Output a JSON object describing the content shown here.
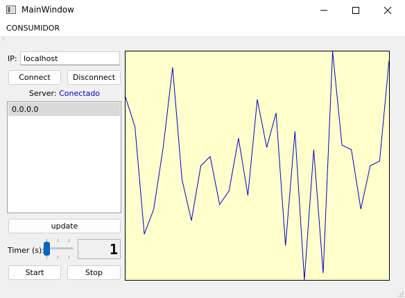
{
  "window": {
    "title": "MainWindow",
    "controls": [
      "minimize-icon",
      "maximize-icon",
      "close-icon"
    ]
  },
  "menu": {
    "items": [
      "CONSUMIDOR"
    ]
  },
  "connection": {
    "ip_label": "IP:",
    "ip_value": "localhost",
    "connect_label": "Connect",
    "disconnect_label": "Disconnect",
    "server_label": "Server:",
    "server_status": "Conectado",
    "status_color": "#0000cc"
  },
  "server_list": {
    "items": [
      "0.0.0.0"
    ],
    "selected_index": 0
  },
  "update_label": "update",
  "timer": {
    "label": "Timer (s):",
    "slider_fraction": 0.0,
    "display_value": "1"
  },
  "start_label": "Start",
  "stop_label": "Stop",
  "plot": {
    "background": "#ffffcc",
    "line_color": "#0000cc",
    "values": [
      0.8,
      0.67,
      0.2,
      0.31,
      0.58,
      0.93,
      0.44,
      0.26,
      0.5,
      0.54,
      0.33,
      0.39,
      0.62,
      0.37,
      0.79,
      0.58,
      0.73,
      0.15,
      0.65,
      0.0,
      0.57,
      0.03,
      1.0,
      0.59,
      0.57,
      0.31,
      0.5,
      0.52,
      0.96
    ]
  }
}
